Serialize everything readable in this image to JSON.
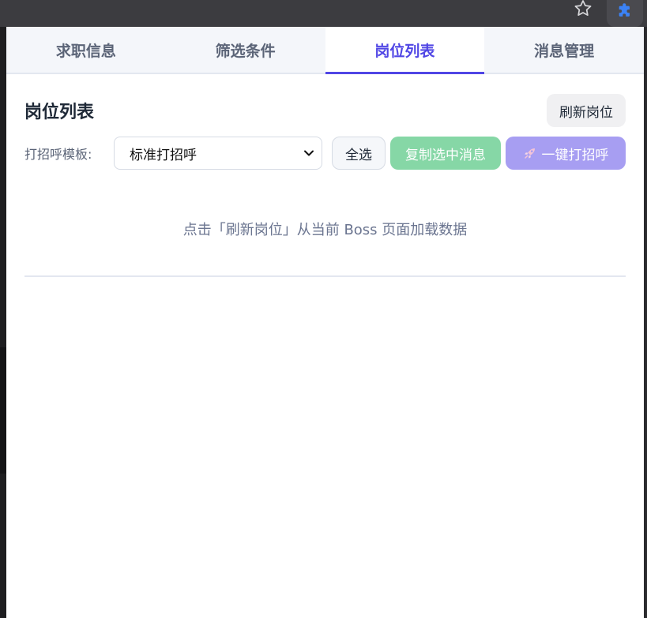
{
  "tabs": [
    {
      "label": "求职信息",
      "active": false
    },
    {
      "label": "筛选条件",
      "active": false
    },
    {
      "label": "岗位列表",
      "active": true
    },
    {
      "label": "消息管理",
      "active": false
    }
  ],
  "section": {
    "title": "岗位列表",
    "refresh_label": "刷新岗位"
  },
  "tools": {
    "template_label": "打招呼模板:",
    "template_selected": "标准打招呼",
    "select_all_label": "全选",
    "copy_label": "复制选中消息",
    "greet_label": "一键打招呼"
  },
  "empty_message": "点击「刷新岗位」从当前 Boss 页面加载数据",
  "colors": {
    "accent": "#5046e5",
    "copy_button": "#86d7a6",
    "greet_button": "#a79ef2",
    "extension_icon": "#3b82f6"
  },
  "icons": {
    "bookmark": "star-icon",
    "extension": "puzzle-icon",
    "greet": "rocket-icon",
    "dropdown": "chevron-down-icon"
  }
}
